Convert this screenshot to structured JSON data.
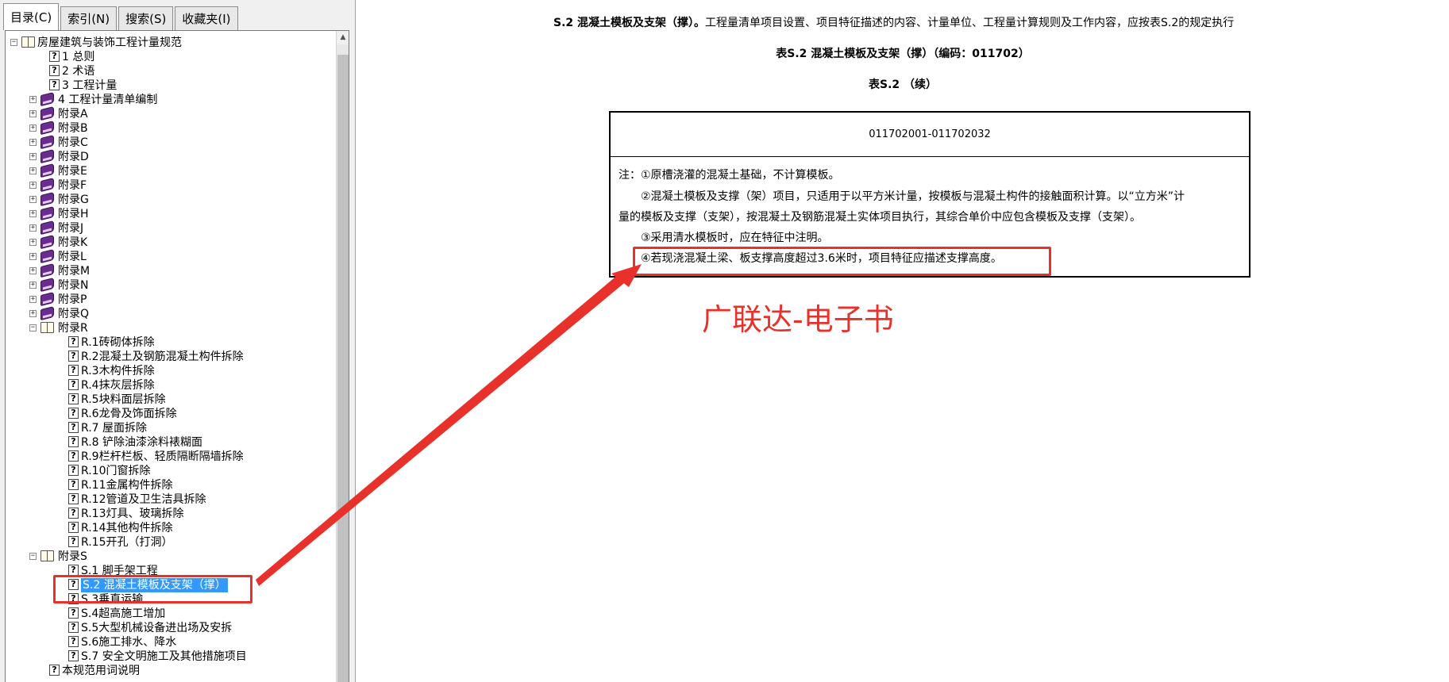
{
  "tabs": [
    {
      "label": "目录(C)"
    },
    {
      "label": "索引(N)"
    },
    {
      "label": "搜索(S)"
    },
    {
      "label": "收藏夹(I)"
    }
  ],
  "tree": {
    "root": "房屋建筑与装饰工程计量规范",
    "items": [
      {
        "label": "1 总则",
        "level": 1,
        "icon": "help-page-icon"
      },
      {
        "label": "2 术语",
        "level": 1,
        "icon": "help-page-icon"
      },
      {
        "label": "3 工程计量",
        "level": 1,
        "icon": "help-page-icon"
      },
      {
        "label": "4 工程计量清单编制",
        "level": 1,
        "icon": "closed-book-icon"
      },
      {
        "label": "附录A",
        "level": 1,
        "icon": "closed-book-icon"
      },
      {
        "label": "附录B",
        "level": 1,
        "icon": "closed-book-icon"
      },
      {
        "label": "附录C",
        "level": 1,
        "icon": "closed-book-icon"
      },
      {
        "label": "附录D",
        "level": 1,
        "icon": "closed-book-icon"
      },
      {
        "label": "附录E",
        "level": 1,
        "icon": "closed-book-icon"
      },
      {
        "label": "附录F",
        "level": 1,
        "icon": "closed-book-icon"
      },
      {
        "label": "附录G",
        "level": 1,
        "icon": "closed-book-icon"
      },
      {
        "label": "附录H",
        "level": 1,
        "icon": "closed-book-icon"
      },
      {
        "label": "附录J",
        "level": 1,
        "icon": "closed-book-icon"
      },
      {
        "label": "附录K",
        "level": 1,
        "icon": "closed-book-icon"
      },
      {
        "label": "附录L",
        "level": 1,
        "icon": "closed-book-icon"
      },
      {
        "label": "附录M",
        "level": 1,
        "icon": "closed-book-icon"
      },
      {
        "label": "附录N",
        "level": 1,
        "icon": "closed-book-icon"
      },
      {
        "label": "附录P",
        "level": 1,
        "icon": "closed-book-icon"
      },
      {
        "label": "附录Q",
        "level": 1,
        "icon": "closed-book-icon"
      },
      {
        "label": "附录R",
        "level": 1,
        "icon": "open-book-icon"
      },
      {
        "label": "R.1砖砌体拆除",
        "level": 2,
        "icon": "help-page-icon"
      },
      {
        "label": "R.2混凝土及钢筋混凝土构件拆除",
        "level": 2,
        "icon": "help-page-icon"
      },
      {
        "label": "R.3木构件拆除",
        "level": 2,
        "icon": "help-page-icon"
      },
      {
        "label": "R.4抹灰层拆除",
        "level": 2,
        "icon": "help-page-icon"
      },
      {
        "label": "R.5块料面层拆除",
        "level": 2,
        "icon": "help-page-icon"
      },
      {
        "label": "R.6龙骨及饰面拆除",
        "level": 2,
        "icon": "help-page-icon"
      },
      {
        "label": "R.7 屋面拆除",
        "level": 2,
        "icon": "help-page-icon"
      },
      {
        "label": "R.8 铲除油漆涂料裱糊面",
        "level": 2,
        "icon": "help-page-icon"
      },
      {
        "label": "R.9栏杆栏板、轻质隔断隔墙拆除",
        "level": 2,
        "icon": "help-page-icon"
      },
      {
        "label": "R.10门窗拆除",
        "level": 2,
        "icon": "help-page-icon"
      },
      {
        "label": "R.11金属构件拆除",
        "level": 2,
        "icon": "help-page-icon"
      },
      {
        "label": "R.12管道及卫生洁具拆除",
        "level": 2,
        "icon": "help-page-icon"
      },
      {
        "label": "R.13灯具、玻璃拆除",
        "level": 2,
        "icon": "help-page-icon"
      },
      {
        "label": "R.14其他构件拆除",
        "level": 2,
        "icon": "help-page-icon"
      },
      {
        "label": "R.15开孔（打洞）",
        "level": 2,
        "icon": "help-page-icon"
      },
      {
        "label": "附录S",
        "level": 1,
        "icon": "open-book-icon"
      },
      {
        "label": "S.1 脚手架工程",
        "level": 2,
        "icon": "help-page-icon"
      },
      {
        "label": "S.2 混凝土模板及支架（撑）",
        "level": 2,
        "icon": "help-page-icon",
        "selected": true
      },
      {
        "label": "S.3垂直运输",
        "level": 2,
        "icon": "help-page-icon"
      },
      {
        "label": "S.4超高施工增加",
        "level": 2,
        "icon": "help-page-icon"
      },
      {
        "label": "S.5大型机械设备进出场及安拆",
        "level": 2,
        "icon": "help-page-icon"
      },
      {
        "label": "S.6施工排水、降水",
        "level": 2,
        "icon": "help-page-icon"
      },
      {
        "label": "S.7 安全文明施工及其他措施项目",
        "level": 2,
        "icon": "help-page-icon"
      },
      {
        "label": "本规范用词说明",
        "level": 1,
        "icon": "help-page-icon"
      }
    ]
  },
  "document": {
    "intro_bold": "S.2 混凝土模板及支架（撑）。",
    "intro_rest": "工程量清单项目设置、项目特征描述的内容、计量单位、工程量计算规则及工作内容，应按表S.2的规定执行",
    "table_title": "表S.2 混凝土模板及支架（撑）（编码：011702）",
    "table_continued": "表S.2 （续）",
    "code_range": "011702001-011702032",
    "notes": [
      "注：①原槽浇灌的混凝土基础，不计算模板。",
      "②混凝土模板及支撑（架）项目，只适用于以平方米计量，按模板与混凝土构件的接触面积计算。以“立方米”计",
      "量的模板及支撑（支架），按混凝土及钢筋混凝土实体项目执行，其综合单价中应包含模板及支撑（支架）。",
      "③采用清水模板时，应在特征中注明。",
      "④若现浇混凝土梁、板支撑高度超过3.6米时，项目特征应描述支撑高度。"
    ]
  },
  "annotation": {
    "watermark": "广联达-电子书",
    "color": "#e8312a"
  }
}
